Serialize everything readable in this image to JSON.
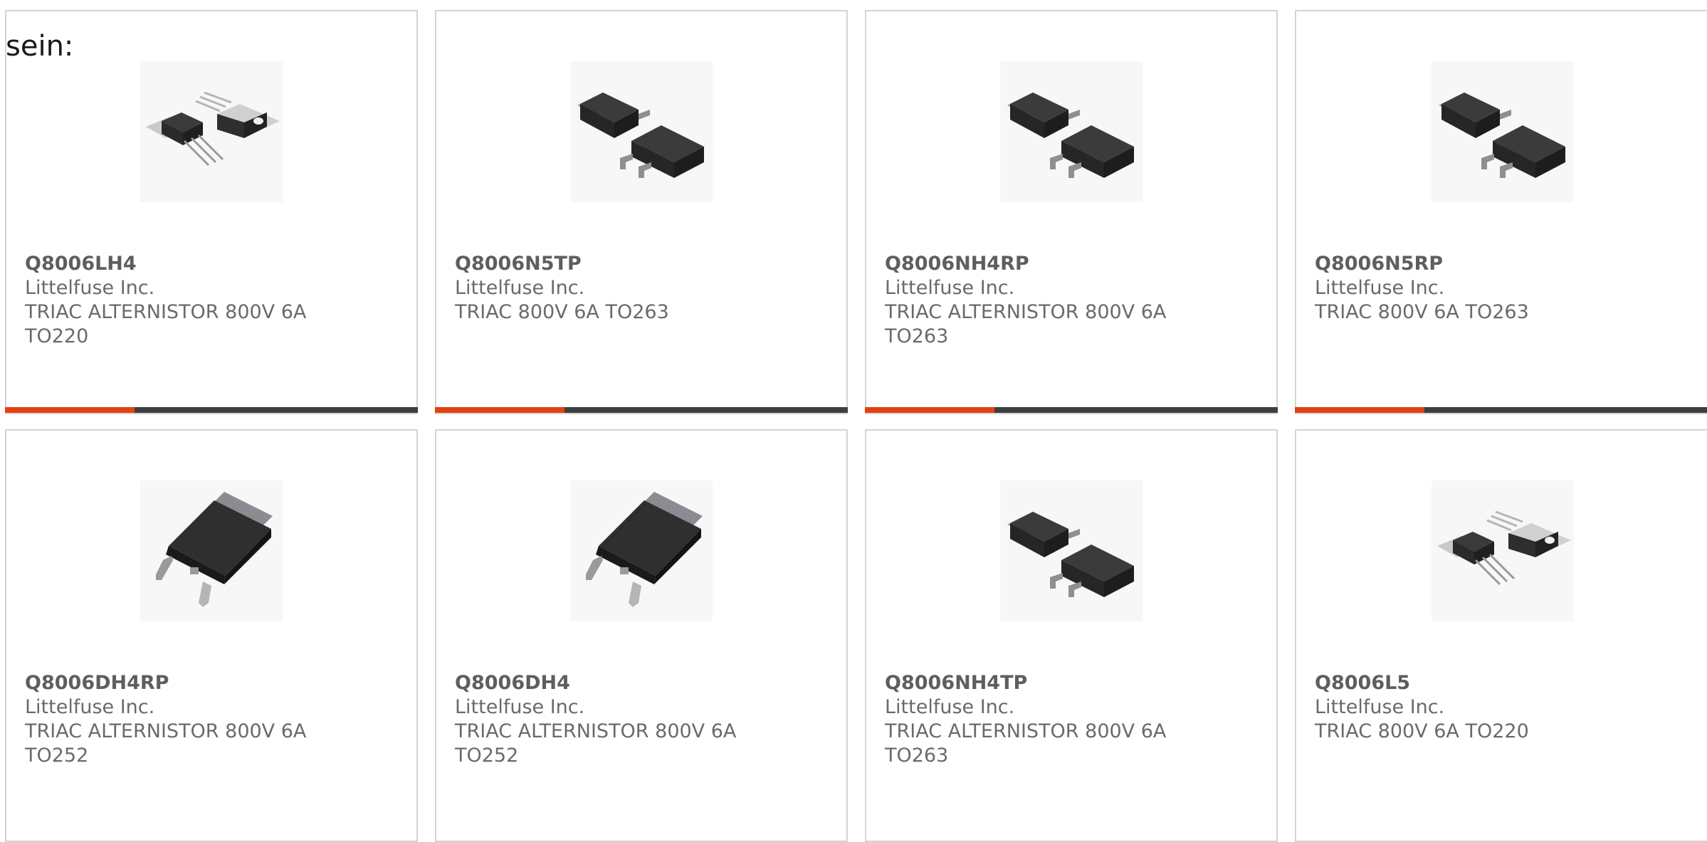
{
  "intro_text": "sein:",
  "colors": {
    "accent": "#e4410f",
    "bar_track": "#3e3e3e",
    "border": "#d4d4d4"
  },
  "products": [
    {
      "part": "Q8006LH4",
      "manufacturer": "Littelfuse Inc.",
      "description": "TRIAC ALTERNISTOR 800V 6A TO220",
      "package_icon": "to220-package-icon",
      "hover_bar": true
    },
    {
      "part": "Q8006N5TP",
      "manufacturer": "Littelfuse Inc.",
      "description": "TRIAC 800V 6A TO263",
      "package_icon": "to263-package-icon",
      "hover_bar": true
    },
    {
      "part": "Q8006NH4RP",
      "manufacturer": "Littelfuse Inc.",
      "description": "TRIAC ALTERNISTOR 800V 6A TO263",
      "package_icon": "to263-package-icon",
      "hover_bar": true
    },
    {
      "part": "Q8006N5RP",
      "manufacturer": "Littelfuse Inc.",
      "description": "TRIAC 800V 6A TO263",
      "package_icon": "to263-package-icon",
      "hover_bar": true
    },
    {
      "part": "Q8006DH4RP",
      "manufacturer": "Littelfuse Inc.",
      "description": "TRIAC ALTERNISTOR 800V 6A TO252",
      "package_icon": "to252-package-icon",
      "hover_bar": false
    },
    {
      "part": "Q8006DH4",
      "manufacturer": "Littelfuse Inc.",
      "description": "TRIAC ALTERNISTOR 800V 6A TO252",
      "package_icon": "to252-package-icon",
      "hover_bar": false
    },
    {
      "part": "Q8006NH4TP",
      "manufacturer": "Littelfuse Inc.",
      "description": "TRIAC ALTERNISTOR 800V 6A TO263",
      "package_icon": "to263-package-icon",
      "hover_bar": false
    },
    {
      "part": "Q8006L5",
      "manufacturer": "Littelfuse Inc.",
      "description": "TRIAC 800V 6A TO220",
      "package_icon": "to220-package-icon",
      "hover_bar": false
    }
  ]
}
